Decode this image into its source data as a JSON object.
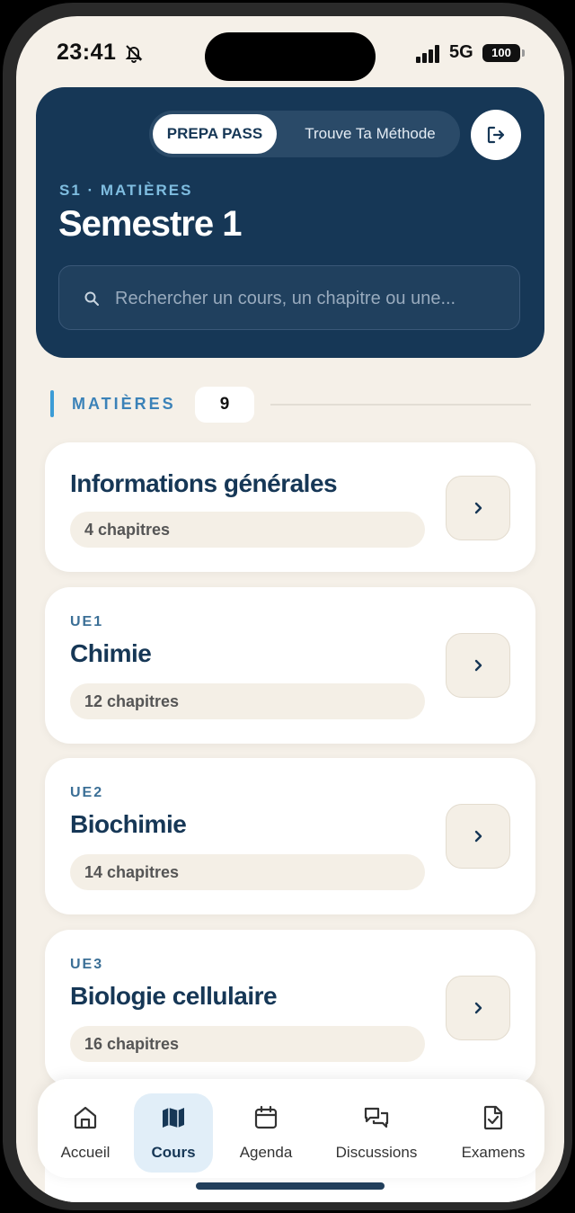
{
  "status_bar": {
    "time": "23:41",
    "network": "5G",
    "battery": "100"
  },
  "header": {
    "toggle": {
      "option_1": "PREPA PASS",
      "option_2": "Trouve Ta Méthode",
      "selected": "PREPA PASS"
    },
    "eyebrow": "S1 · MATIÈRES",
    "title": "Semestre 1",
    "search_placeholder": "Rechercher un cours, un chapitre ou une..."
  },
  "section": {
    "label": "MATIÈRES",
    "count": "9"
  },
  "subjects": [
    {
      "code": "",
      "name": "Informations générales",
      "chapters": "4 chapitres"
    },
    {
      "code": "UE1",
      "name": "Chimie",
      "chapters": "12 chapitres"
    },
    {
      "code": "UE2",
      "name": "Biochimie",
      "chapters": "14 chapitres"
    },
    {
      "code": "UE3",
      "name": "Biologie cellulaire",
      "chapters": "16 chapitres"
    }
  ],
  "tabbar": {
    "items": [
      {
        "label": "Accueil",
        "icon": "home-icon"
      },
      {
        "label": "Cours",
        "icon": "map-icon"
      },
      {
        "label": "Agenda",
        "icon": "calendar-icon"
      },
      {
        "label": "Discussions",
        "icon": "chat-icon"
      },
      {
        "label": "Examens",
        "icon": "exam-icon"
      }
    ],
    "active": "Cours"
  },
  "colors": {
    "navy": "#163756",
    "accent": "#3c9cd6",
    "background": "#f5f0e8",
    "active_tab": "#e1eef8"
  }
}
